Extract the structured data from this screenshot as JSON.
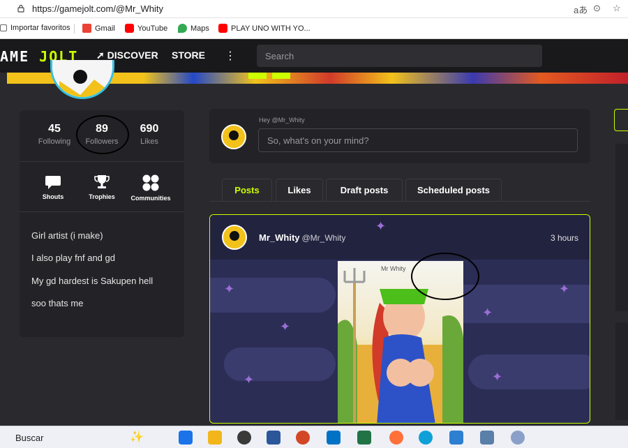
{
  "browser": {
    "url": "https://gamejolt.com/@Mr_Whity",
    "bookmarks": [
      {
        "label": "Importar favoritos",
        "color": "#555555"
      },
      {
        "label": "Gmail",
        "color": "#ea4335"
      },
      {
        "label": "YouTube",
        "color": "#ff0000"
      },
      {
        "label": "Maps",
        "color": "#34a853"
      },
      {
        "label": "PLAY UNO WITH YO...",
        "color": "#ff0000"
      }
    ]
  },
  "nav": {
    "logo_a": "AME ",
    "logo_b": "JOLT",
    "discover": "DISCOVER",
    "store": "STORE",
    "kebab": "⋮",
    "search_placeholder": "Search"
  },
  "profile": {
    "stats": [
      {
        "value": "45",
        "label": "Following"
      },
      {
        "value": "89",
        "label": "Followers"
      },
      {
        "value": "690",
        "label": "Likes"
      }
    ],
    "quick": [
      {
        "label": "Shouts"
      },
      {
        "label": "Trophies"
      },
      {
        "label": "Communities"
      }
    ],
    "bio": [
      "Girl artist (i make)",
      "I also play fnf and gd",
      "My gd hardest is Sakupen hell",
      "soo thats me"
    ]
  },
  "composer": {
    "greeting": "Hey @Mr_Whity",
    "placeholder": "So, what's on your mind?"
  },
  "tabs": [
    {
      "label": "Posts",
      "active": true
    },
    {
      "label": "Likes",
      "active": false
    },
    {
      "label": "Draft posts",
      "active": false
    },
    {
      "label": "Scheduled posts",
      "active": false
    }
  ],
  "post": {
    "author": "Mr_Whity",
    "handle": "@Mr_Whity",
    "time": "3 hours"
  },
  "taskbar": {
    "search_label": "Buscar"
  },
  "colors": {
    "accent": "#ccff00",
    "nav_bg": "#19191b",
    "page_bg": "#2a2a2e",
    "card_bg": "#232327"
  }
}
